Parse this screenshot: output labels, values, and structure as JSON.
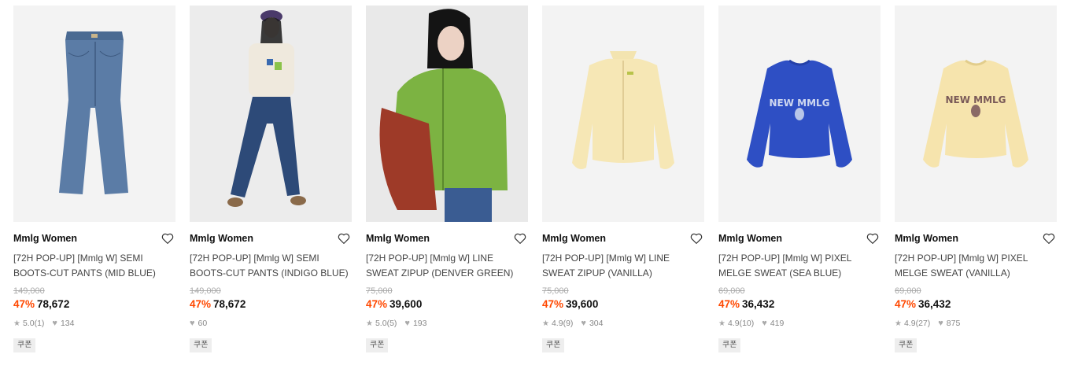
{
  "products": [
    {
      "brand": "Mmlg Women",
      "name_line1": "[72H POP-UP] [Mmlg W] SEMI",
      "name_line2": "BOOTS-CUT PANTS (MID BLUE)",
      "original_price": "149,000",
      "discount": "47%",
      "price": "78,672",
      "rating": "5.0",
      "reviews": "(1)",
      "likes": "134",
      "coupon": "쿠폰",
      "image": "jeans-mid-blue"
    },
    {
      "brand": "Mmlg Women",
      "name_line1": "[72H POP-UP] [Mmlg W] SEMI",
      "name_line2": "BOOTS-CUT PANTS (INDIGO BLUE)",
      "original_price": "149,000",
      "discount": "47%",
      "price": "78,672",
      "rating": "",
      "reviews": "",
      "likes": "60",
      "coupon": "쿠폰",
      "image": "model-indigo-jeans"
    },
    {
      "brand": "Mmlg Women",
      "name_line1": "[72H POP-UP] [Mmlg W] LINE",
      "name_line2": "SWEAT ZIPUP (DENVER GREEN)",
      "original_price": "75,000",
      "discount": "47%",
      "price": "39,600",
      "rating": "5.0",
      "reviews": "(5)",
      "likes": "193",
      "coupon": "쿠폰",
      "image": "model-green-zipup"
    },
    {
      "brand": "Mmlg Women",
      "name_line1": "[72H POP-UP] [Mmlg W] LINE",
      "name_line2": "SWEAT ZIPUP (VANILLA)",
      "original_price": "75,000",
      "discount": "47%",
      "price": "39,600",
      "rating": "4.9",
      "reviews": "(9)",
      "likes": "304",
      "coupon": "쿠폰",
      "image": "zipup-vanilla"
    },
    {
      "brand": "Mmlg Women",
      "name_line1": "[72H POP-UP] [Mmlg W] PIXEL",
      "name_line2": "MELGE SWEAT (SEA BLUE)",
      "original_price": "69,000",
      "discount": "47%",
      "price": "36,432",
      "rating": "4.9",
      "reviews": "(10)",
      "likes": "419",
      "coupon": "쿠폰",
      "image": "sweat-sea-blue",
      "print_text": "NEW MMLG"
    },
    {
      "brand": "Mmlg Women",
      "name_line1": "[72H POP-UP] [Mmlg W] PIXEL",
      "name_line2": "MELGE SWEAT (VANILLA)",
      "original_price": "69,000",
      "discount": "47%",
      "price": "36,432",
      "rating": "4.9",
      "reviews": "(27)",
      "likes": "875",
      "coupon": "쿠폰",
      "image": "sweat-vanilla",
      "print_text": "NEW MMLG"
    }
  ],
  "colors": {
    "discount": "#ff4800",
    "thumb_bg": "#f2f2f2",
    "coupon_bg": "#eeeeee"
  },
  "icons": {
    "wishlist": "heart-outline-icon",
    "rating": "star-icon",
    "likes": "heart-filled-icon"
  }
}
